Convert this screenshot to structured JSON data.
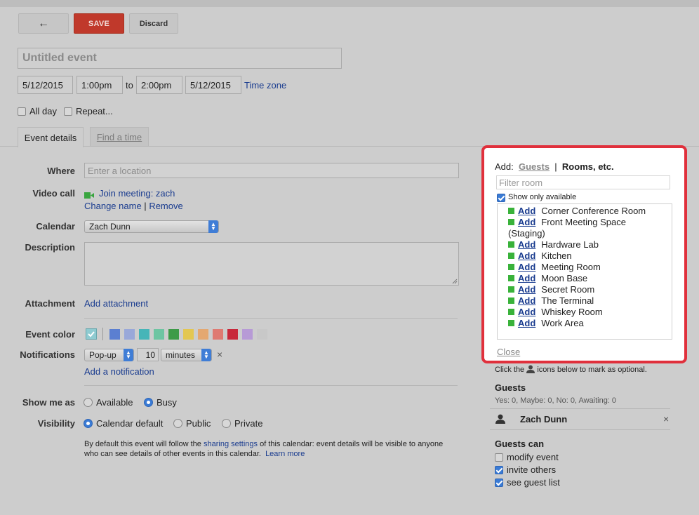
{
  "toolbar": {
    "back_icon": "←",
    "save_label": "SAVE",
    "discard_label": "Discard"
  },
  "event": {
    "title_placeholder": "Untitled event",
    "start_date": "5/12/2015",
    "start_time": "1:00pm",
    "to_label": "to",
    "end_time": "2:00pm",
    "end_date": "5/12/2015",
    "time_zone_link": "Time zone",
    "all_day_label": "All day",
    "repeat_label": "Repeat..."
  },
  "tabs": {
    "event_details": "Event details",
    "find_a_time": "Find a time"
  },
  "details": {
    "where_label": "Where",
    "where_placeholder": "Enter a location",
    "video_label": "Video call",
    "video_link": "Join meeting: zach",
    "change_name": "Change name",
    "pipe": "|",
    "remove": "Remove",
    "calendar_label": "Calendar",
    "calendar_value": "Zach Dunn",
    "description_label": "Description",
    "attachment_label": "Attachment",
    "attachment_link": "Add attachment",
    "color_label": "Event color",
    "notifications_label": "Notifications",
    "notif_type": "Pop-up",
    "notif_amount": "10",
    "notif_unit": "minutes",
    "notif_remove": "×",
    "add_notification": "Add a notification",
    "show_me_label": "Show me as",
    "available": "Available",
    "busy": "Busy",
    "visibility_label": "Visibility",
    "vis_default": "Calendar default",
    "vis_public": "Public",
    "vis_private": "Private",
    "note_1": "By default this event will follow the ",
    "note_link": "sharing settings",
    "note_2": " of this calendar: event details will be visible to anyone",
    "note_3": "who can see details of other events in this calendar.",
    "learn_more": "Learn more"
  },
  "colors": [
    "#5b7fd1",
    "#99a8d9",
    "#46b5b8",
    "#6ec5a2",
    "#3d9b48",
    "#e3c752",
    "#e4a871",
    "#df7a72",
    "#c8283b",
    "#b79ad6",
    "#c8c8c8"
  ],
  "selected_color": "#8fcbd1",
  "rooms_panel": {
    "add_label": "Add:",
    "guests_tab": "Guests",
    "divider": "|",
    "rooms_tab": "Rooms, etc.",
    "filter_placeholder": "Filter room",
    "show_available": "Show only available",
    "add_word": "Add",
    "rooms": [
      "Corner Conference Room",
      "Front Meeting Space (Staging)",
      "Hardware Lab",
      "Kitchen",
      "Meeting Room",
      "Moon Base",
      "Secret Room",
      "The Terminal",
      "Whiskey Room",
      "Work Area"
    ],
    "close": "Close"
  },
  "guests": {
    "hint_1": "Click the",
    "hint_2": "icons below to mark as optional.",
    "title": "Guests",
    "summary": "Yes: 0, Maybe: 0, No: 0, Awaiting: 0",
    "guest_name": "Zach Dunn",
    "remove": "×",
    "guests_can": "Guests can",
    "modify": "modify event",
    "invite": "invite others",
    "see_list": "see guest list"
  }
}
